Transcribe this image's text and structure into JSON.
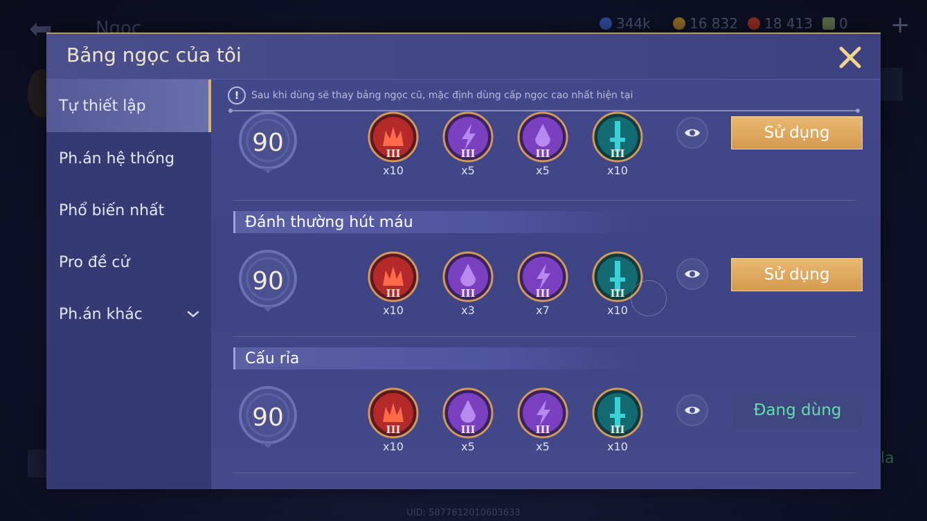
{
  "background": {
    "back_title": "Ngọc",
    "resources": [
      {
        "icon": "blue-coin-icon",
        "value": "344k",
        "color": "#3b5fbf"
      },
      {
        "icon": "gold-coin-icon",
        "value": "16 832",
        "color": "#b88a2a"
      },
      {
        "icon": "red-gem-icon",
        "value": "18 413",
        "color": "#c0392b"
      },
      {
        "icon": "card-icon",
        "value": "0",
        "color": "#8a9a6a"
      }
    ],
    "uid": "UID: 5877612010603633"
  },
  "panel": {
    "title": "Bảng ngọc của tôi"
  },
  "sidebar": {
    "items": [
      {
        "label": "Tự thiết lập",
        "active": true
      },
      {
        "label": "Ph.án hệ thống",
        "active": false
      },
      {
        "label": "Phổ biến nhất",
        "active": false
      },
      {
        "label": "Pro đề cử",
        "active": false
      },
      {
        "label": "Ph.án khác",
        "active": false,
        "has_dropdown": true
      }
    ]
  },
  "notice": "Sau khi dùng sẽ thay bảng ngọc cũ, mặc định dùng cấp ngọc cao nhất hiện tại",
  "sections": [
    {
      "header": "Đánh thường hút máu"
    },
    {
      "header": "Cấu rỉa"
    }
  ],
  "rows": [
    {
      "level": "90",
      "gems": [
        {
          "type": "red-crown-gem",
          "tier": "III",
          "count": "x10"
        },
        {
          "type": "purple-lightning-gem",
          "tier": "III",
          "count": "x5"
        },
        {
          "type": "purple-drop-gem",
          "tier": "III",
          "count": "x5"
        },
        {
          "type": "teal-sword-gem",
          "tier": "III",
          "count": "x10"
        }
      ],
      "action": "Sử dụng"
    },
    {
      "level": "90",
      "gems": [
        {
          "type": "red-crown-gem",
          "tier": "III",
          "count": "x10"
        },
        {
          "type": "purple-drop-gem",
          "tier": "III",
          "count": "x3"
        },
        {
          "type": "purple-lightning-gem",
          "tier": "III",
          "count": "x7"
        },
        {
          "type": "teal-sword-gem",
          "tier": "III",
          "count": "x10"
        }
      ],
      "action": "Sử dụng"
    },
    {
      "level": "90",
      "gems": [
        {
          "type": "red-crown-gem",
          "tier": "III",
          "count": "x10"
        },
        {
          "type": "purple-drop-gem",
          "tier": "III",
          "count": "x5"
        },
        {
          "type": "purple-lightning-gem",
          "tier": "III",
          "count": "x5"
        },
        {
          "type": "teal-sword-gem",
          "tier": "III",
          "count": "x10"
        }
      ],
      "action": "Đang dùng"
    }
  ],
  "colors": {
    "accent_gold": "#d9b46a",
    "in_use_green": "#5fe0a8",
    "panel_bg": "#3a3f78"
  }
}
